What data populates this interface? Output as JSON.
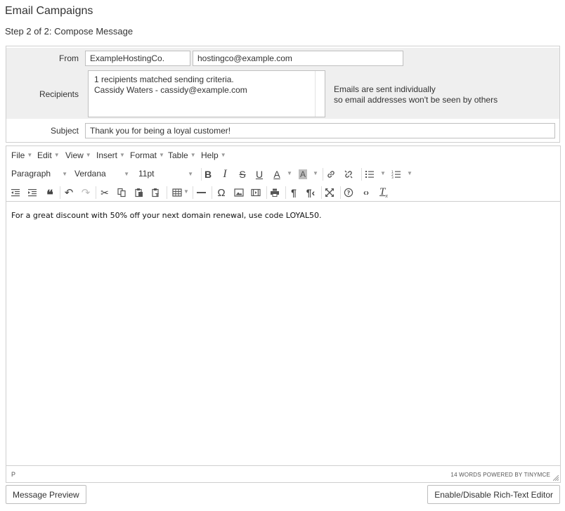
{
  "page": {
    "title": "Email Campaigns",
    "step": "Step 2 of 2: Compose Message"
  },
  "form": {
    "from_label": "From",
    "from_name": "ExampleHostingCo.",
    "from_email": "hostingco@example.com",
    "recipients_label": "Recipients",
    "recipients_lines": [
      "1 recipients matched sending criteria.",
      "Cassidy Waters - cassidy@example.com"
    ],
    "recipients_note": [
      "Emails are sent individually",
      "so email addresses won't be seen by others"
    ],
    "subject_label": "Subject",
    "subject_value": "Thank you for being a loyal customer!"
  },
  "editor": {
    "menu": [
      "File",
      "Edit",
      "View",
      "Insert",
      "Format",
      "Table",
      "Help"
    ],
    "block_format": "Paragraph",
    "font_family": "Verdana",
    "font_size": "11pt",
    "toolbar_icons": [
      "bold-icon",
      "italic-icon",
      "strikethrough-icon",
      "underline-icon",
      "text-color-icon",
      "background-color-icon",
      "link-icon",
      "unlink-icon",
      "bullet-list-icon",
      "numbered-list-icon",
      "outdent-icon",
      "indent-icon",
      "blockquote-icon",
      "undo-icon",
      "redo-icon",
      "cut-icon",
      "copy-icon",
      "paste-icon",
      "paste-text-icon",
      "table-icon",
      "horizontal-rule-icon",
      "special-char-icon",
      "image-icon",
      "media-icon",
      "print-icon",
      "ltr-icon",
      "rtl-icon",
      "fullscreen-icon",
      "help-icon",
      "code-icon",
      "remove-format-icon"
    ],
    "body": "For a great discount with 50% off your next domain renewal, use code LOYAL50.",
    "status_path": "P",
    "word_count": "14 WORDS POWERED BY TINYMCE"
  },
  "actions": {
    "preview": "Message Preview",
    "toggle_rich_text": "Enable/Disable Rich-Text Editor"
  },
  "colors": {
    "row_bg": "#efefef",
    "border": "#cfcfcf",
    "text": "#333333"
  }
}
